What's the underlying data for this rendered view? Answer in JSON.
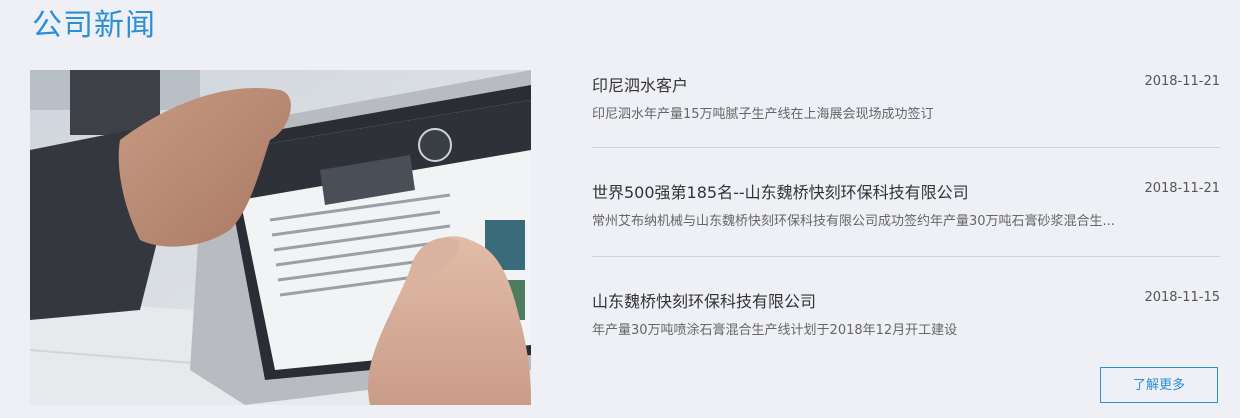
{
  "section": {
    "title": "公司新闻"
  },
  "news": [
    {
      "title": "印尼泗水客户",
      "date": "2018-11-21",
      "summary": "印尼泗水年产量15万吨腻子生产线在上海展会现场成功签订"
    },
    {
      "title": "世界500强第185名--山东魏桥快刻环保科技有限公司",
      "date": "2018-11-21",
      "summary": "常州艾布纳机械与山东魏桥快刻环保科技有限公司成功签约年产量30万吨石膏砂浆混合生..."
    },
    {
      "title": "山东魏桥快刻环保科技有限公司",
      "date": "2018-11-15",
      "summary": "年产量30万吨喷涂石膏混合生产线计划于2018年12月开工建设"
    }
  ],
  "more_button": {
    "label": "了解更多"
  }
}
